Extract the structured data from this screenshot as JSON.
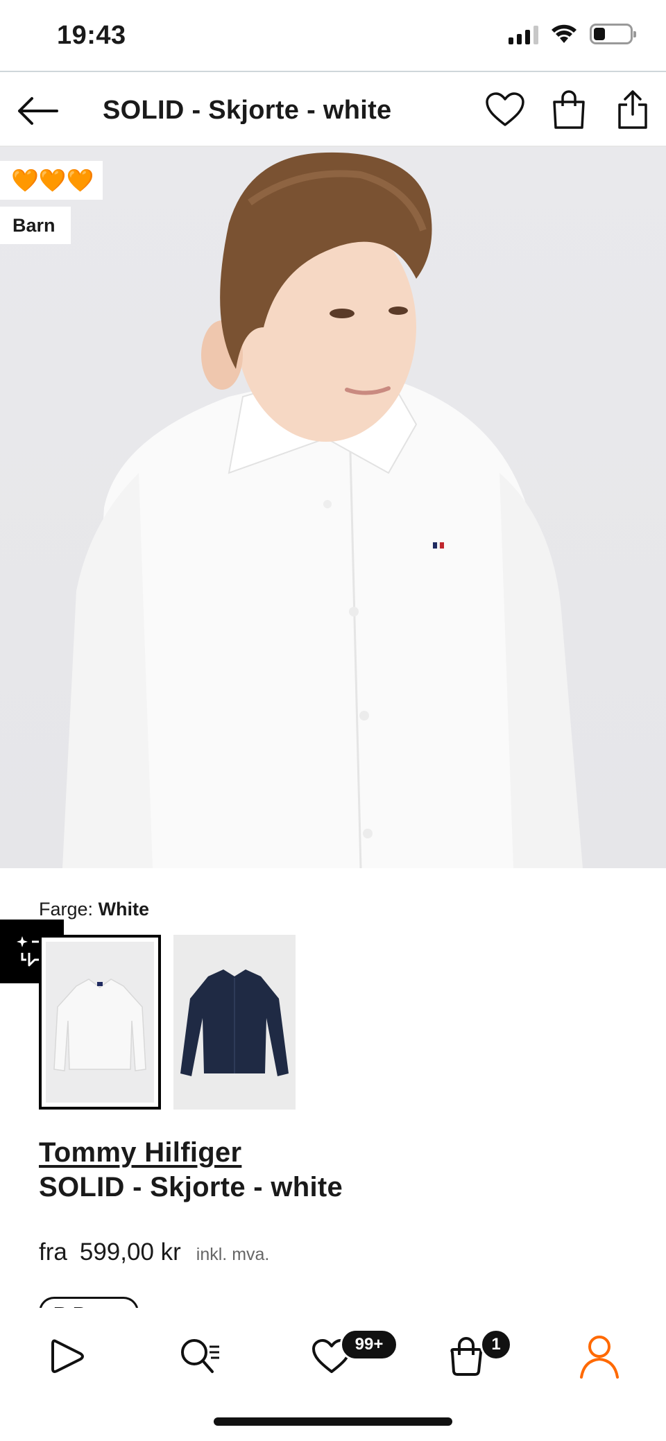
{
  "status_bar": {
    "time": "19:43"
  },
  "header": {
    "title": "SOLID - Skjorte - white"
  },
  "hero": {
    "hearts": "🧡🧡🧡",
    "tag": "Barn"
  },
  "color": {
    "label": "Farge:",
    "value": "White"
  },
  "swatches": [
    {
      "name": "White",
      "selected": true,
      "color": "#f7f7f7"
    },
    {
      "name": "Navy",
      "selected": false,
      "color": "#1f2a44"
    }
  ],
  "product": {
    "brand": "Tommy Hilfiger",
    "name": "SOLID - Skjorte - white",
    "price_from": "fra",
    "price": "599,00 kr",
    "vat": "inkl. mva.",
    "pill_peek": "B P..."
  },
  "nav": {
    "wishlist_badge": "99+",
    "bag_badge": "1"
  },
  "colors": {
    "accent": "#ff6900",
    "badge": "#111111",
    "heart": "#f59a23"
  }
}
